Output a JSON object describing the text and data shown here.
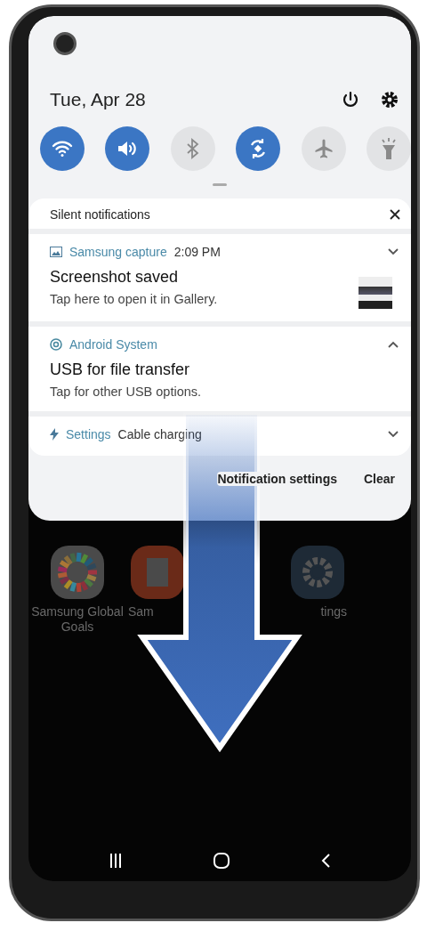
{
  "status": {
    "date": "Tue, Apr 28"
  },
  "quick_tiles": [
    {
      "kind": "wifi",
      "on": true
    },
    {
      "kind": "sound",
      "on": true
    },
    {
      "kind": "bluetooth",
      "on": false
    },
    {
      "kind": "rotate",
      "on": true
    },
    {
      "kind": "airplane",
      "on": false
    },
    {
      "kind": "flashlight",
      "on": false
    }
  ],
  "notifications": {
    "header": "Silent notifications",
    "items": [
      {
        "kind": "full",
        "app": "Samsung capture",
        "time": "2:09 PM",
        "title": "Screenshot saved",
        "body": "Tap here to open it in Gallery.",
        "expanded": false,
        "thumbnail": true
      },
      {
        "kind": "full",
        "app": "Android System",
        "title": "USB for file transfer",
        "body": "Tap for other USB options.",
        "expanded": true,
        "thumbnail": false
      },
      {
        "kind": "compact",
        "app": "Settings",
        "title": "Cable charging",
        "expanded": false
      }
    ],
    "actions": [
      "Notification settings",
      "Clear"
    ]
  },
  "home_apps": [
    {
      "kind": "goals",
      "label": "Samsung Global Goals"
    },
    {
      "kind": "orange",
      "label": "Sam"
    },
    {
      "kind": "gear",
      "label": "tings"
    }
  ]
}
